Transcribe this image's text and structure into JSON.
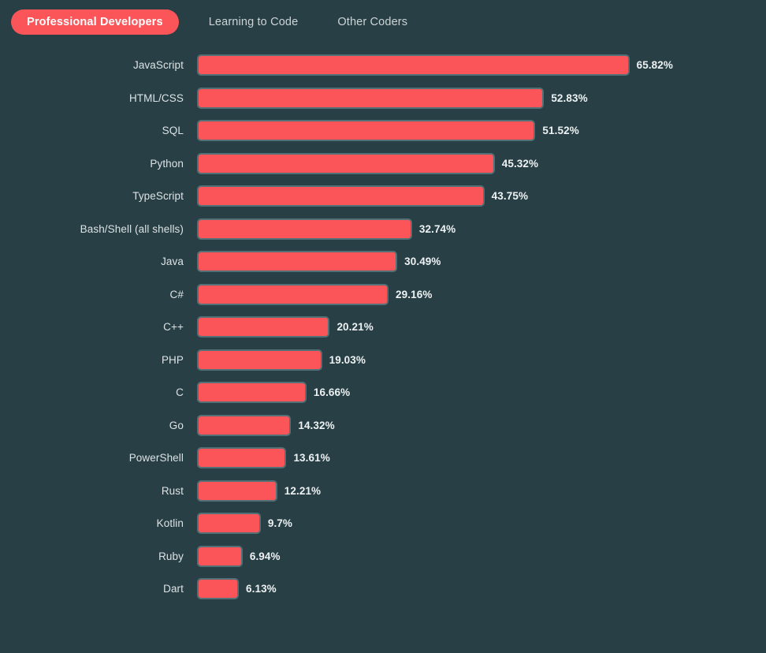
{
  "tabs": [
    {
      "label": "Professional Developers",
      "active": true
    },
    {
      "label": "Learning to Code",
      "active": false
    },
    {
      "label": "Other Coders",
      "active": false
    }
  ],
  "colors": {
    "background": "#273f45",
    "bar_fill": "#fb5559",
    "bar_border": "#527075",
    "active_tab_bg": "#fb5559",
    "active_tab_text": "#ffffff",
    "inactive_tab_text": "#ccd4d7",
    "label_text": "#dde3e5",
    "value_text": "#eef2f3"
  },
  "chart_data": {
    "type": "bar",
    "orientation": "horizontal",
    "title": "",
    "subtitle": "",
    "xlabel": "",
    "ylabel": "",
    "grid": false,
    "legend": false,
    "value_suffix": "%",
    "xlim": [
      0,
      65.82
    ],
    "categories": [
      "JavaScript",
      "HTML/CSS",
      "SQL",
      "Python",
      "TypeScript",
      "Bash/Shell (all shells)",
      "Java",
      "C#",
      "C++",
      "PHP",
      "C",
      "Go",
      "PowerShell",
      "Rust",
      "Kotlin",
      "Ruby",
      "Dart"
    ],
    "values": [
      65.82,
      52.83,
      51.52,
      45.32,
      43.75,
      32.74,
      30.49,
      29.16,
      20.21,
      19.03,
      16.66,
      14.32,
      13.61,
      12.21,
      9.7,
      6.94,
      6.13
    ],
    "labels": [
      "65.82%",
      "52.83%",
      "51.52%",
      "45.32%",
      "43.75%",
      "32.74%",
      "30.49%",
      "29.16%",
      "20.21%",
      "19.03%",
      "16.66%",
      "14.32%",
      "13.61%",
      "12.21%",
      "9.7%",
      "6.94%",
      "6.13%"
    ]
  }
}
